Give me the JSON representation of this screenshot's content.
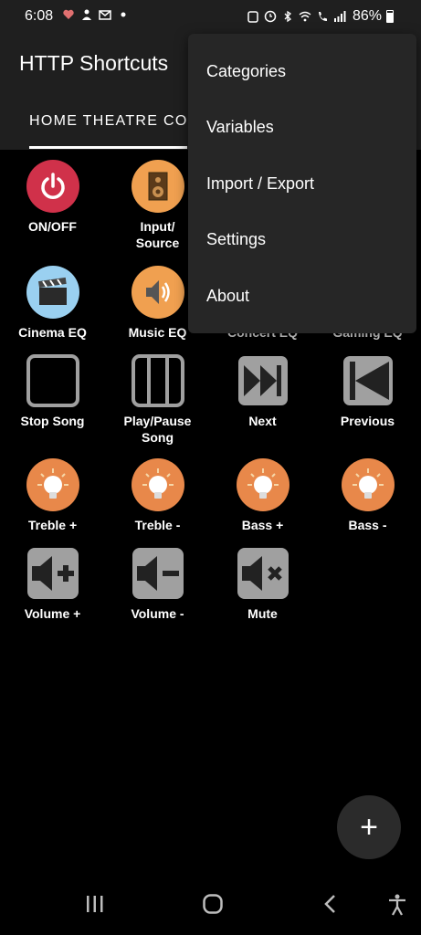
{
  "status": {
    "time": "6:08",
    "battery": "86%"
  },
  "app": {
    "title": "HTTP Shortcuts",
    "tab": "HOME THEATRE CO"
  },
  "menu": {
    "items": [
      "Categories",
      "Variables",
      "Import / Export",
      "Settings",
      "About"
    ]
  },
  "shortcuts": [
    {
      "label": "ON/OFF",
      "icon": "power-icon",
      "color": "#d0314a"
    },
    {
      "label": "Input/\nSource",
      "icon": "speaker-icon",
      "color": "#f0a050"
    },
    {
      "label": "",
      "icon": "",
      "color": ""
    },
    {
      "label": "",
      "icon": "",
      "color": ""
    },
    {
      "label": "Cinema EQ",
      "icon": "clapperboard-icon",
      "color": "#9ad0f0"
    },
    {
      "label": "Music EQ",
      "icon": "volume-speaker-icon",
      "color": "#f0a050"
    },
    {
      "label": "Concert EQ",
      "icon": "",
      "color": ""
    },
    {
      "label": "Gaming EQ",
      "icon": "",
      "color": ""
    },
    {
      "label": "Stop Song",
      "icon": "stop-icon",
      "color": "#a0a0a0"
    },
    {
      "label": "Play/Pause\nSong",
      "icon": "pause-icon",
      "color": "#a0a0a0"
    },
    {
      "label": "Next",
      "icon": "next-icon",
      "color": "#a0a0a0"
    },
    {
      "label": "Previous",
      "icon": "previous-icon",
      "color": "#a0a0a0"
    },
    {
      "label": "Treble +",
      "icon": "lightbulb-icon",
      "color": "#e8884a"
    },
    {
      "label": "Treble -",
      "icon": "lightbulb-icon",
      "color": "#e8884a"
    },
    {
      "label": "Bass +",
      "icon": "lightbulb-icon",
      "color": "#e8884a"
    },
    {
      "label": "Bass -",
      "icon": "lightbulb-icon",
      "color": "#e8884a"
    },
    {
      "label": "Volume +",
      "icon": "volume-up-icon",
      "color": "#a0a0a0"
    },
    {
      "label": "Volume -",
      "icon": "volume-down-icon",
      "color": "#a0a0a0"
    },
    {
      "label": "Mute",
      "icon": "mute-icon",
      "color": "#a0a0a0"
    }
  ],
  "fab": {
    "label": "+"
  }
}
